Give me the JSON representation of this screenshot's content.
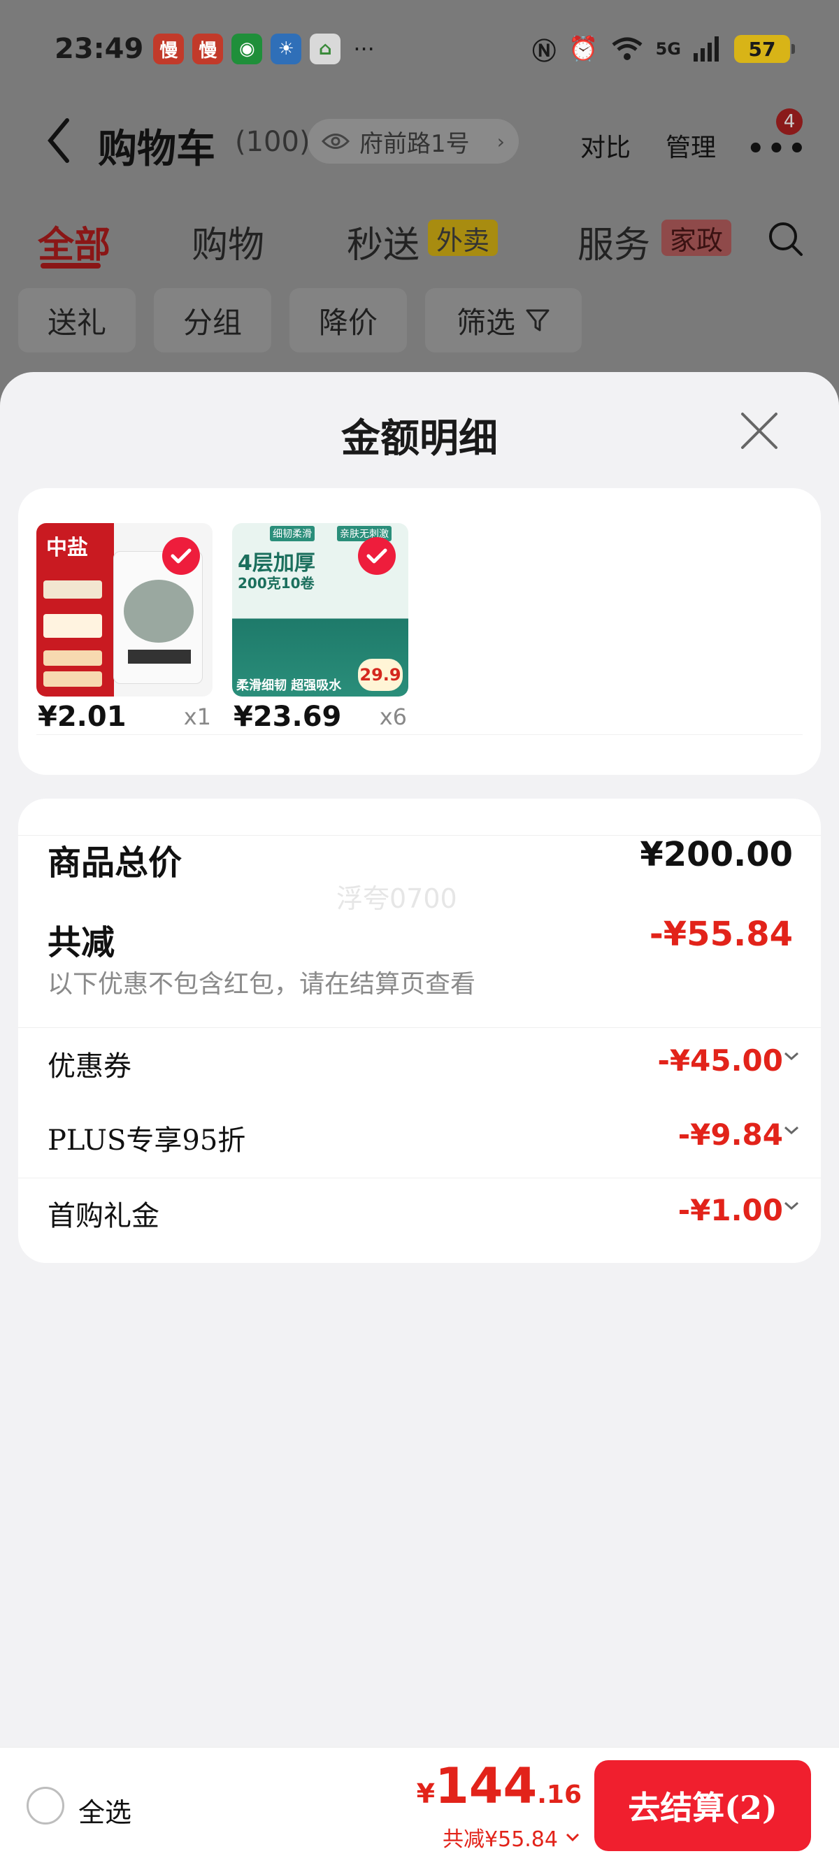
{
  "status_bar": {
    "time": "23:49",
    "apps": [
      {
        "name": "man-app-icon",
        "glyph": "慢",
        "color": "#c23a2a"
      },
      {
        "name": "man-app-icon",
        "glyph": "慢",
        "color": "#c23a2a"
      },
      {
        "name": "wechat-icon",
        "glyph": "◉",
        "color": "#1f8f3a"
      },
      {
        "name": "weather-icon",
        "glyph": "☀",
        "color": "#2f6fb8"
      },
      {
        "name": "home-app-icon",
        "glyph": "⌂",
        "color": "#d9d9d9"
      }
    ],
    "more": "···",
    "network": "5G",
    "battery": "57"
  },
  "header": {
    "title": "购物车",
    "count": "(100)",
    "location": "府前路1号",
    "compare": "对比",
    "manage": "管理",
    "more_badge": "4"
  },
  "tabs": {
    "all": "全部",
    "shopping": "购物",
    "flash": "秒送",
    "flash_tag": "外卖",
    "service": "服务",
    "service_tag": "家政"
  },
  "chips": {
    "gift": "送礼",
    "group": "分组",
    "price_drop": "降价",
    "filter": "筛选"
  },
  "sheet": {
    "title": "金额明细",
    "products": [
      {
        "price": "¥2.01",
        "qty": "x1"
      },
      {
        "price": "¥23.69",
        "qty": "x6"
      }
    ],
    "product_1_brand": "中盐",
    "product_2_headline": "4层加厚",
    "product_2_sub": "200克10卷",
    "product_2_tags": [
      "细韧柔滑",
      "亲肤无刺激"
    ],
    "product_2_footer": "柔滑细韧 超强吸水",
    "product_2_price": "29.9",
    "summary": {
      "total_label": "商品总价",
      "total_value": "¥200.00",
      "reduce_label": "共减",
      "reduce_value": "-¥55.84",
      "reduce_note": "以下优惠不包含红包，请在结算页查看",
      "watermark": "浮夸0700",
      "discounts": [
        {
          "label": "优惠券",
          "value": "-¥45.00"
        },
        {
          "label": "PLUS专享95折",
          "value": "-¥9.84"
        },
        {
          "label": "首购礼金",
          "value": "-¥1.00"
        }
      ]
    }
  },
  "footer": {
    "select_all": "全选",
    "currency": "¥",
    "total_int": "144",
    "total_dec": ".16",
    "reduced": "共减¥55.84",
    "checkout": "去结算(2)"
  },
  "colors": {
    "accent_red": "#e2231a",
    "checkout_red": "#f01f2e",
    "dim_overlay": "#7a7a7a"
  }
}
